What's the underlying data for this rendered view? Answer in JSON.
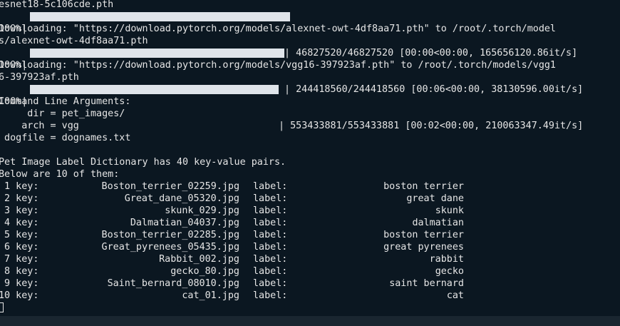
{
  "terminal": {
    "lines": [
      "esnet18-5c106cde.pth",
      "Downloading: \"https://download.pytorch.org/models/alexnet-owt-4df8aa71.pth\" to /root/.torch/model",
      "s/alexnet-owt-4df8aa71.pth",
      "Downloading: \"https://download.pytorch.org/models/vgg16-397923af.pth\" to /root/.torch/models/vgg1",
      "6-397923af.pth",
      "Command Line Arguments:",
      "     dir = pet_images/",
      "    arch = vgg",
      " dogfile = dognames.txt",
      "Pet Image Label Dictionary has 40 key-value pairs.",
      "Below are 10 of them:"
    ],
    "progress": [
      {
        "prefix": "100%|",
        "suffix": "| 46827520/46827520 [00:00<00:00, 165656120.86it/s]",
        "fraction": 1.0
      },
      {
        "prefix": "100%|",
        "suffix": "| 244418560/244418560 [00:06<00:00, 38130596.00it/s]",
        "fraction": 1.0
      },
      {
        "prefix": "100%|",
        "suffix": "| 553433881/553433881 [00:02<00:00, 210063347.49it/s]",
        "fraction": 1.0
      }
    ],
    "table": [
      {
        "num": " 1 key:",
        "file": "Boston_terrier_02259.jpg",
        "lbl": "label:",
        "value": "boston terrier"
      },
      {
        "num": " 2 key:",
        "file": "Great_dane_05320.jpg",
        "lbl": "label:",
        "value": "great dane"
      },
      {
        "num": " 3 key:",
        "file": "skunk_029.jpg",
        "lbl": "label:",
        "value": "skunk"
      },
      {
        "num": " 4 key:",
        "file": "Dalmatian_04037.jpg",
        "lbl": "label:",
        "value": "dalmatian"
      },
      {
        "num": " 5 key:",
        "file": "Boston_terrier_02285.jpg",
        "lbl": "label:",
        "value": "boston terrier"
      },
      {
        "num": " 6 key:",
        "file": "Great_pyrenees_05435.jpg",
        "lbl": "label:",
        "value": "great pyrenees"
      },
      {
        "num": " 7 key:",
        "file": "Rabbit_002.jpg",
        "lbl": "label:",
        "value": "rabbit"
      },
      {
        "num": " 8 key:",
        "file": "gecko_80.jpg",
        "lbl": "label:",
        "value": "gecko"
      },
      {
        "num": " 9 key:",
        "file": "Saint_bernard_08010.jpg",
        "lbl": "label:",
        "value": "saint bernard"
      },
      {
        "num": "10 key:",
        "file": "cat_01.jpg",
        "lbl": "label:",
        "value": "cat"
      }
    ],
    "colors": {
      "background": "#0b1721",
      "text": "#e6e6e6",
      "bar": "#dfe4ea"
    }
  }
}
